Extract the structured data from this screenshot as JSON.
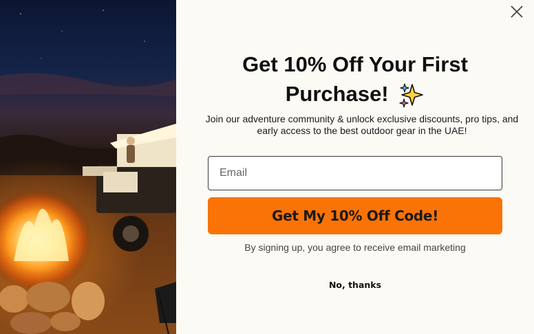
{
  "popup": {
    "headline_line1": "Get 10% Off Your First",
    "headline_line2": "Purchase!",
    "subtext": "Join our adventure community & unlock exclusive discounts, pro tips, and early access to the best outdoor gear in the UAE!",
    "email_placeholder": "Email",
    "email_value": "",
    "cta_label": "Get My 10% Off Code!",
    "disclaimer": "By signing up, you agree to receive email marketing",
    "decline_label": "No, thanks",
    "close_icon": "close-icon",
    "sparkle_icon": "sparkles-icon"
  },
  "colors": {
    "accent": "#f97306",
    "background": "#fbfaf4",
    "text": "#111111"
  }
}
